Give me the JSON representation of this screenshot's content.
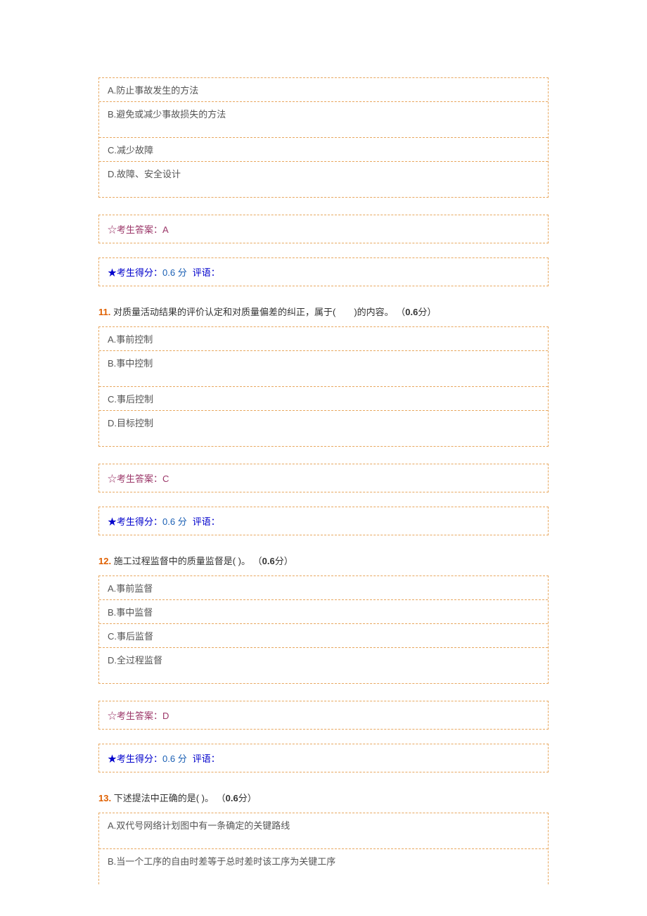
{
  "q10": {
    "options": {
      "A": "A.防止事故发生的方法",
      "B": "B.避免或减少事故损失的方法",
      "C": "C.减少故障",
      "D": "D.故障、安全设计"
    },
    "answer_label": "☆考生答案：",
    "answer_value": "A",
    "score_star": "★",
    "score_label": "考生得分：",
    "score_value": "0.6 分",
    "comment_label": "评语："
  },
  "q11": {
    "num": "11.",
    "text": "对质量活动结果的评价认定和对质量偏差的纠正，属于(  )的内容。",
    "points_open": " （",
    "points_value": "0.6",
    "points_unit": "分）",
    "options": {
      "A": "A.事前控制",
      "B": "B.事中控制",
      "C": "C.事后控制",
      "D": "D.目标控制"
    },
    "answer_label": "☆考生答案：",
    "answer_value": "C",
    "score_star": "★",
    "score_label": "考生得分：",
    "score_value": "0.6 分",
    "comment_label": "评语："
  },
  "q12": {
    "num": "12.",
    "text": "施工过程监督中的质量监督是( )。",
    "points_open": " （",
    "points_value": "0.6",
    "points_unit": "分）",
    "options": {
      "A": "A.事前监督",
      "B": "B.事中监督",
      "C": "C.事后监督",
      "D": "D.全过程监督"
    },
    "answer_label": "☆考生答案：",
    "answer_value": "D",
    "score_star": "★",
    "score_label": "考生得分：",
    "score_value": "0.6 分",
    "comment_label": "评语："
  },
  "q13": {
    "num": "13.",
    "text": "下述提法中正确的是( )。",
    "points_open": " （",
    "points_value": "0.6",
    "points_unit": "分）",
    "options": {
      "A": "A.双代号网络计划图中有一条确定的关键路线",
      "B": "B.当一个工序的自由时差等于总时差时该工序为关键工序"
    }
  }
}
